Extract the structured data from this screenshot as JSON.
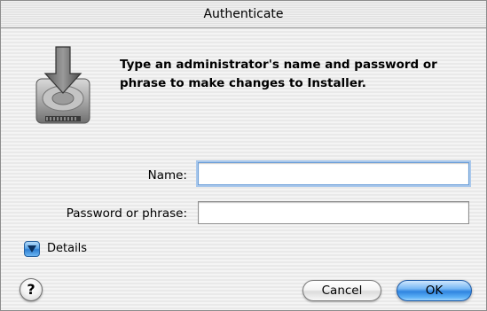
{
  "window": {
    "title": "Authenticate"
  },
  "icon": {
    "name": "installer-disk-icon"
  },
  "message": "Type an administrator's name and password or phrase to make changes to Installer.",
  "form": {
    "name_label": "Name:",
    "name_value": "",
    "password_label": "Password or phrase:",
    "password_value": ""
  },
  "details": {
    "label": "Details",
    "expanded": false
  },
  "buttons": {
    "help_label": "?",
    "cancel_label": "Cancel",
    "ok_label": "OK"
  },
  "colors": {
    "accent": "#3b8ee6",
    "focus_ring": "#a9c8ec"
  }
}
